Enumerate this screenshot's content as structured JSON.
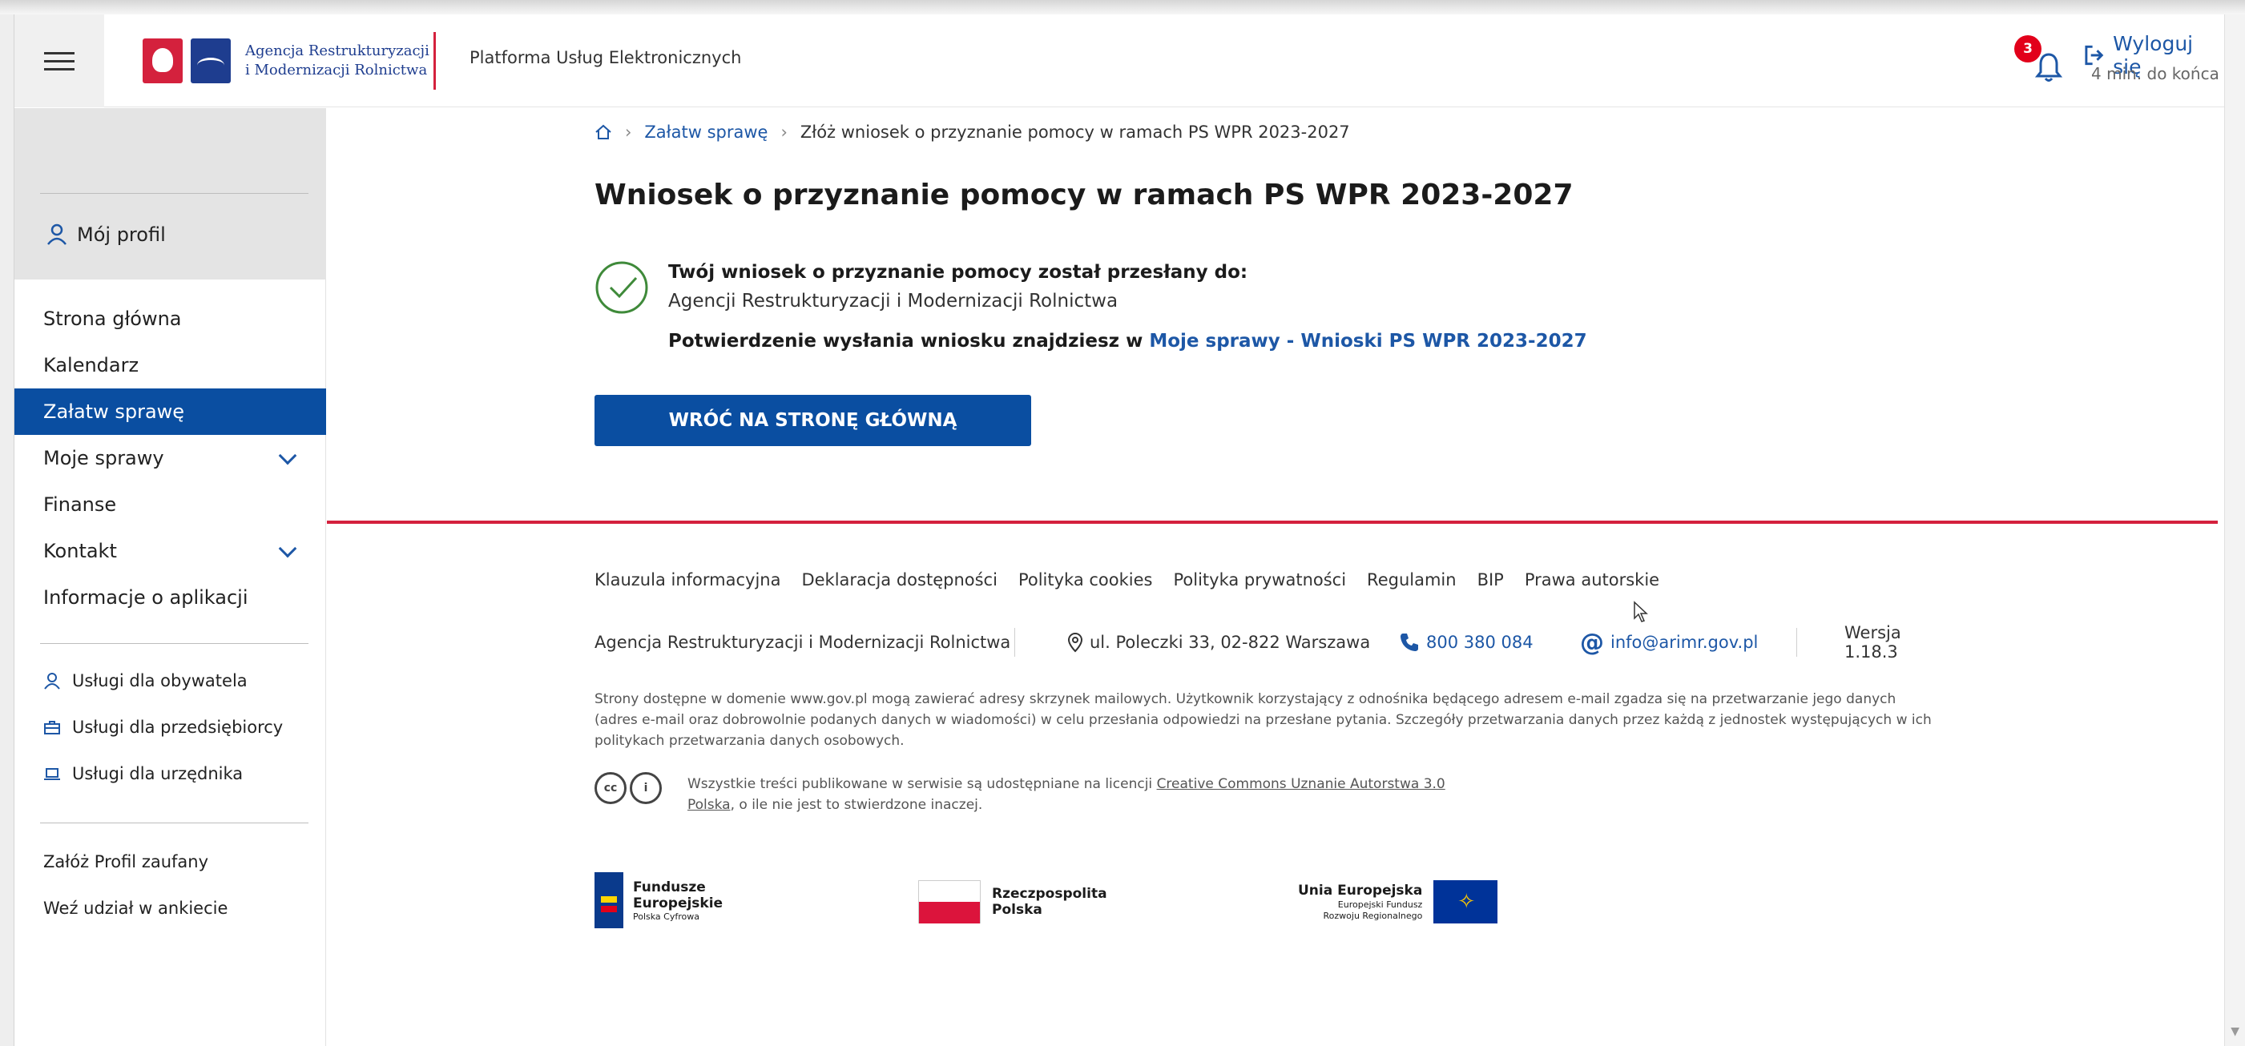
{
  "header": {
    "logo_line1": "Agencja Restrukturyzacji",
    "logo_line2": "i Modernizacji Rolnictwa",
    "platform": "Platforma Usług Elektronicznych",
    "notifications_count": "3",
    "logout_label": "Wyloguj się",
    "countdown": "4 min. do końca"
  },
  "sidebar": {
    "profile_label": "Mój profil",
    "items": [
      {
        "label": "Strona główna"
      },
      {
        "label": "Kalendarz"
      },
      {
        "label": "Załatw sprawę"
      },
      {
        "label": "Moje sprawy"
      },
      {
        "label": "Finanse"
      },
      {
        "label": "Kontakt"
      },
      {
        "label": "Informacje o aplikacji"
      }
    ],
    "services": [
      {
        "label": "Usługi dla obywatela",
        "icon": "person-icon"
      },
      {
        "label": "Usługi dla przedsiębiorcy",
        "icon": "briefcase-icon"
      },
      {
        "label": "Usługi dla urzędnika",
        "icon": "laptop-icon"
      }
    ],
    "extras": [
      {
        "label": "Załóż Profil zaufany"
      },
      {
        "label": "Weź udział w ankiecie"
      }
    ]
  },
  "breadcrumb": {
    "home_icon": "home-icon",
    "item1": "Załatw sprawę",
    "item2": "Złóż wniosek o przyznanie pomocy w ramach PS WPR 2023-2027"
  },
  "main": {
    "title": "Wniosek o przyznanie pomocy w ramach PS WPR 2023-2027",
    "confirm_head": "Twój wniosek o przyznanie pomocy został przesłany do:",
    "confirm_agency": "Agencji Restrukturyzacji i Modernizacji Rolnictwa",
    "confirm_line_prefix": "Potwierdzenie wysłania wniosku znajdziesz w",
    "confirm_link": "Moje sprawy - Wnioski PS WPR 2023-2027",
    "back_button": "WRÓĆ NA STRONĘ GŁÓWNĄ"
  },
  "footer": {
    "links": [
      "Klauzula informacyjna",
      "Deklaracja dostępności",
      "Polityka cookies",
      "Polityka prywatności",
      "Regulamin",
      "BIP",
      "Prawa autorskie"
    ],
    "agency": "Agencja Restrukturyzacji i Modernizacji Rolnictwa",
    "address": "ul. Poleczki 33, 02-822 Warszawa",
    "phone": "800 380 084",
    "email": "info@arimr.gov.pl",
    "version": "Wersja 1.18.3",
    "note": "Strony dostępne w domenie www.gov.pl mogą zawierać adresy skrzynek mailowych. Użytkownik korzystający z odnośnika będącego adresem e-mail zgadza się na przetwarzanie jego danych (adres e-mail oraz dobrowolnie podanych danych w wiadomości) w celu przesłania odpowiedzi na przesłane pytania. Szczegóły przetwarzania danych przez każdą z jednostek występujących w ich politykach przetwarzania danych osobowych.",
    "cc_prefix": "Wszystkie treści publikowane w serwisie są udostępniane na licencji",
    "cc_link": "Creative Commons Uznanie Autorstwa 3.0 Polska",
    "cc_suffix": ", o ile nie jest to stwierdzone inaczej.",
    "fe_line1": "Fundusze",
    "fe_line2": "Europejskie",
    "fe_line3": "Polska Cyfrowa",
    "rp_line1": "Rzeczpospolita",
    "rp_line2": "Polska",
    "ue_line1": "Unia Europejska",
    "ue_line2": "Europejski Fundusz",
    "ue_line3": "Rozwoju Regionalnego"
  },
  "colors": {
    "brand_blue": "#0a4ea1",
    "link_blue": "#1d57a6",
    "accent_red": "#d4213d",
    "success_green": "#3f8a3a"
  }
}
